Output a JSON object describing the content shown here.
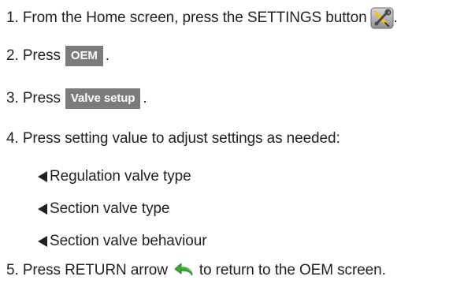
{
  "steps": [
    {
      "num": "1.",
      "text_before": "From the Home screen, press the SETTINGS button",
      "text_after": ".",
      "icon": "settings-tools-icon"
    },
    {
      "num": "2.",
      "text_before": "Press",
      "button": "OEM",
      "text_after": "."
    },
    {
      "num": "3.",
      "text_before": "Press",
      "button": "Valve setup",
      "text_after": "."
    },
    {
      "num": "4.",
      "text": "Press setting value to adjust settings as needed:"
    },
    {
      "num": "5.",
      "text_before": "Press RETURN arrow",
      "text_after": "to return to the OEM screen.",
      "icon": "return-arrow-icon"
    }
  ],
  "settings_items": [
    "Regulation valve type",
    "Section valve type",
    "Section valve behaviour"
  ],
  "colors": {
    "text": "#231f20",
    "button_bg": "#7b7b7b",
    "button_text": "#ffffff",
    "return_arrow": "#3aa935"
  }
}
